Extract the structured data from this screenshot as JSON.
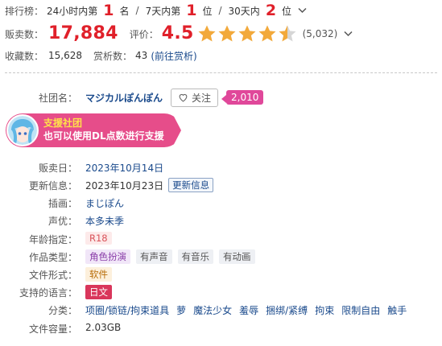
{
  "ranking": {
    "label": "排行榜：",
    "p1_pre": "24小时内第",
    "p1_num": "1",
    "p1_suf": "名",
    "sep1": "/",
    "p2_pre": "7天内第",
    "p2_num": "1",
    "p2_suf": "位",
    "sep2": "/",
    "p3_pre": "30天内",
    "p3_num": "2",
    "p3_suf": "位"
  },
  "sales": {
    "label": "贩卖数：",
    "value": "17,884",
    "rating_label": "评价：",
    "rating": "4.5",
    "rating_stars": 4.5,
    "rating_count": "(5,032)"
  },
  "favorites": {
    "label": "收藏数：",
    "value": "15,628",
    "review_label": "赏析数：",
    "review_value": "43",
    "review_link": "(前往赏析)"
  },
  "circle": {
    "label": "社团名",
    "name": "マジカルぽんぽん",
    "follow_label": "关注",
    "follow_count": "2,010"
  },
  "support": {
    "line1": "支援社团",
    "line2": "也可以使用DL点数进行支援"
  },
  "details": {
    "release_label": "贩卖日",
    "release_value": "2023年10月14日",
    "update_label": "更新信息",
    "update_value": "2023年10月23日",
    "update_btn": "更新信息",
    "illust_label": "插画",
    "illust_value": "まじぽん",
    "voice_label": "声优",
    "voice_value": "本多未季",
    "age_label": "年龄指定",
    "age_value": "R18",
    "type_label": "作品类型",
    "types": [
      "角色扮演",
      "有声音",
      "有音乐",
      "有动画"
    ],
    "format_label": "文件形式",
    "format_value": "软件",
    "lang_label": "支持的语言",
    "lang_value": "日文",
    "genre_label": "分类",
    "genres": [
      "项圈/锁链/拘束道具",
      "萝",
      "魔法少女",
      "羞辱",
      "捆绑/紧缚",
      "拘束",
      "限制自由",
      "触手"
    ],
    "size_label": "文件容量",
    "size_value": "2.03GB"
  },
  "colors": {
    "accent_red": "#e0202a",
    "star_orange": "#f2a93b",
    "link_blue": "#1a4a8c",
    "pink": "#e64d8a"
  }
}
